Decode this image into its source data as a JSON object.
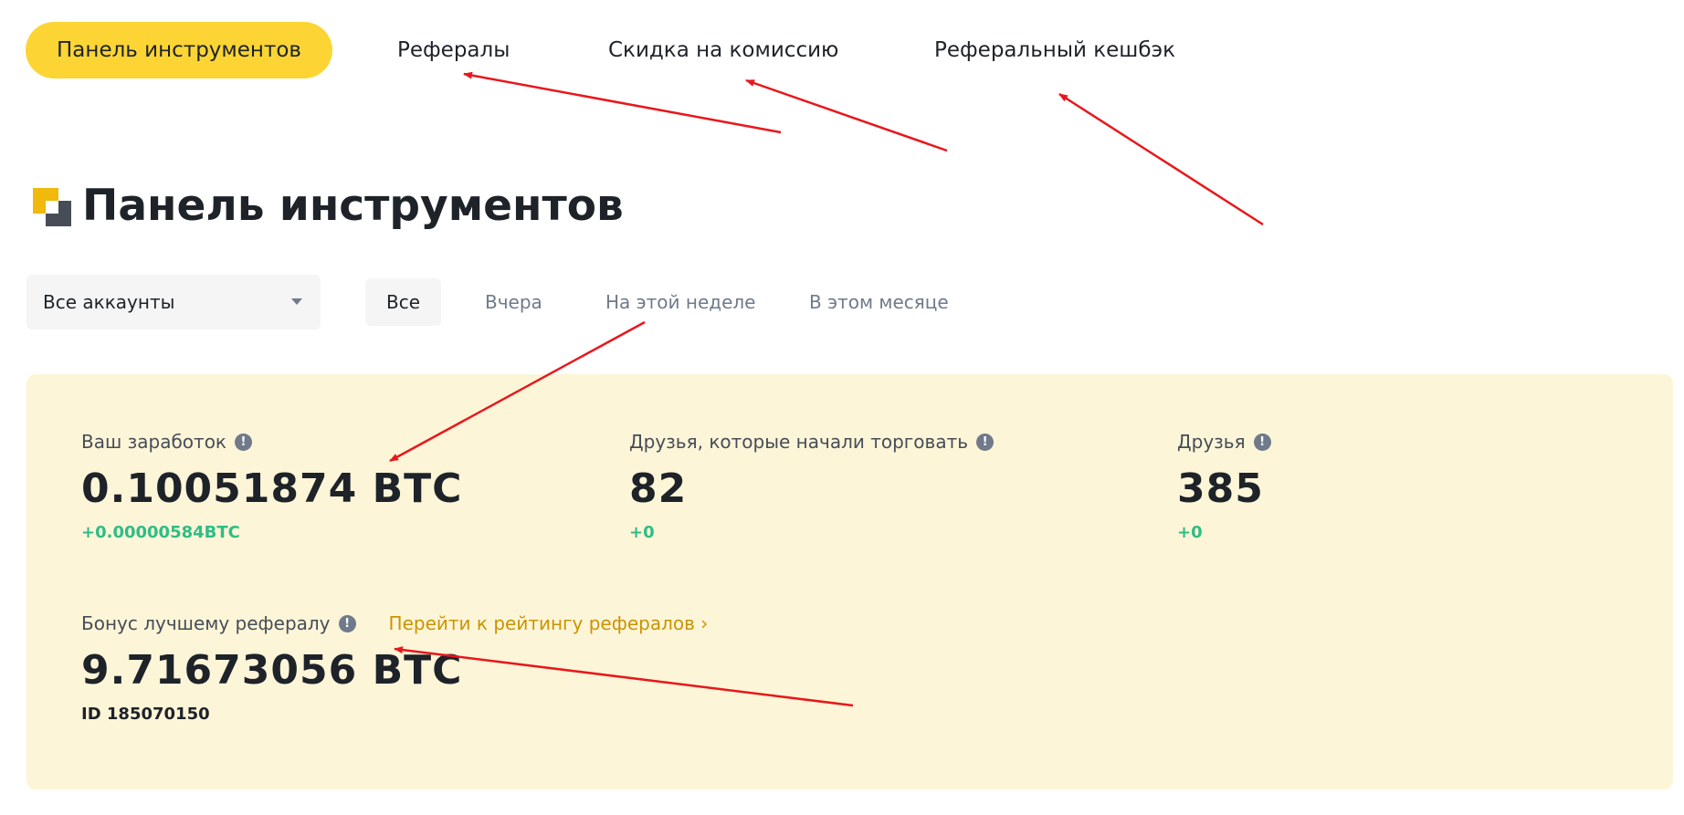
{
  "nav": {
    "tabs": [
      {
        "label": "Панель инструментов",
        "active": true
      },
      {
        "label": "Рефералы"
      },
      {
        "label": "Скидка на комиссию"
      },
      {
        "label": "Реферальный кешбэк"
      }
    ]
  },
  "page": {
    "title": "Панель инструментов"
  },
  "filters": {
    "account_select": "Все аккаунты",
    "periods": [
      "Все",
      "Вчера",
      "На этой неделе",
      "В этом месяце"
    ],
    "active_period": "Все"
  },
  "stats": {
    "earnings": {
      "label": "Ваш заработок",
      "value": "0.10051874 BTC",
      "delta": "+0.00000584BTC"
    },
    "trading_friends": {
      "label": "Друзья, которые начали торговать",
      "value": "82",
      "delta": "+0"
    },
    "friends": {
      "label": "Друзья",
      "value": "385",
      "delta": "+0"
    },
    "top_referral_bonus": {
      "label": "Бонус лучшему рефералу",
      "link": "Перейти к рейтингу рефералов ›",
      "value": "9.71673056 BTC",
      "id": "ID 185070150"
    }
  },
  "colors": {
    "accent": "#fcd535",
    "panel_bg": "#fdf5d8",
    "positive": "#2ebd85",
    "link": "#c99400",
    "annotation_arrow": "#e8171b"
  }
}
